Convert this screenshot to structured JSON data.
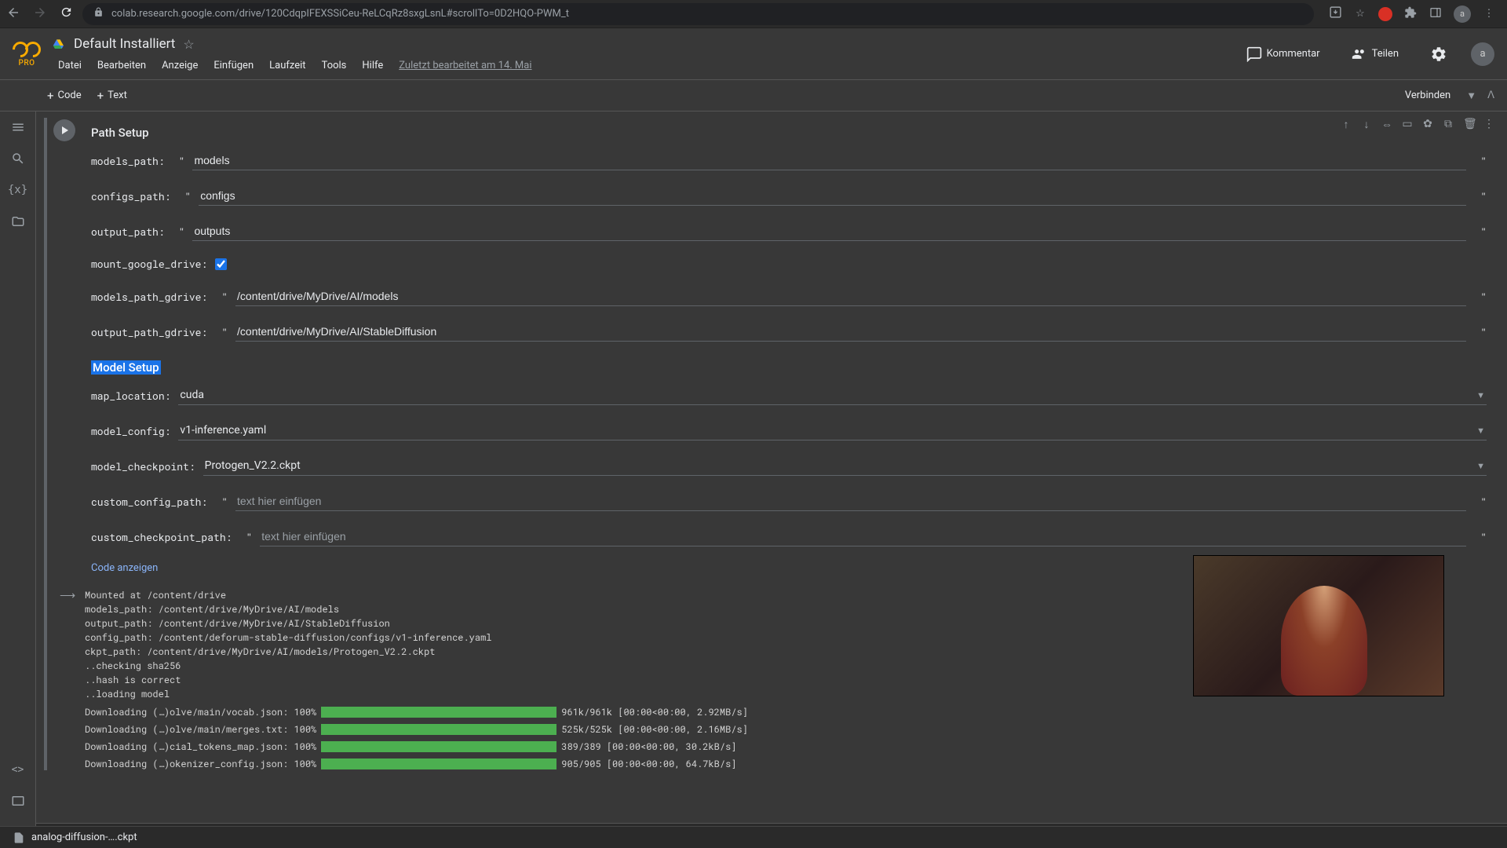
{
  "browser": {
    "url": "colab.research.google.com/drive/120CdqpIFEXSSiCeu-ReLCqRz8sxgLsnL#scrollTo=0D2HQO-PWM_t"
  },
  "header": {
    "pro_badge": "PRO",
    "title": "Default Installiert",
    "menus": [
      "Datei",
      "Bearbeiten",
      "Anzeige",
      "Einfügen",
      "Laufzeit",
      "Tools",
      "Hilfe"
    ],
    "last_edit": "Zuletzt bearbeitet am 14. Mai",
    "comment": "Kommentar",
    "share": "Teilen",
    "avatar": "a"
  },
  "toolbar": {
    "code_btn": "Code",
    "text_btn": "Text",
    "connect": "Verbinden"
  },
  "cell": {
    "section1_title": "Path Setup",
    "section2_title": "Model Setup",
    "params": {
      "models_path": {
        "label": "models_path:",
        "value": "models"
      },
      "configs_path": {
        "label": "configs_path:",
        "value": "configs"
      },
      "output_path": {
        "label": "output_path:",
        "value": "outputs"
      },
      "mount_google_drive": {
        "label": "mount_google_drive:"
      },
      "models_path_gdrive": {
        "label": "models_path_gdrive:",
        "value": "/content/drive/MyDrive/AI/models"
      },
      "output_path_gdrive": {
        "label": "output_path_gdrive:",
        "value": "/content/drive/MyDrive/AI/StableDiffusion"
      },
      "map_location": {
        "label": "map_location:",
        "value": "cuda"
      },
      "model_config": {
        "label": "model_config:",
        "value": "v1-inference.yaml"
      },
      "model_checkpoint": {
        "label": "model_checkpoint:",
        "value": "Protogen_V2.2.ckpt"
      },
      "custom_config_path": {
        "label": "custom_config_path:",
        "placeholder": "text hier einfügen"
      },
      "custom_checkpoint_path": {
        "label": "custom_checkpoint_path:",
        "placeholder": "text hier einfügen"
      }
    },
    "show_code": "Code anzeigen"
  },
  "output": {
    "lines": "Mounted at /content/drive\nmodels_path: /content/drive/MyDrive/AI/models\noutput_path: /content/drive/MyDrive/AI/StableDiffusion\nconfig_path: /content/deforum-stable-diffusion/configs/v1-inference.yaml\nckpt_path: /content/drive/MyDrive/AI/models/Protogen_V2.2.ckpt\n..checking sha256\n..hash is correct\n..loading model",
    "downloads": [
      {
        "label": "Downloading (…)olve/main/vocab.json: 100%",
        "info": "961k/961k [00:00<00:00, 2.92MB/s]"
      },
      {
        "label": "Downloading (…)olve/main/merges.txt: 100%",
        "info": "525k/525k [00:00<00:00, 2.16MB/s]"
      },
      {
        "label": "Downloading (…)cial_tokens_map.json: 100%",
        "info": "389/389 [00:00<00:00, 30.2kB/s]"
      },
      {
        "label": "Downloading (…)okenizer_config.json: 100%",
        "info": "905/905 [00:00<00:00, 64.7kB/s]"
      }
    ]
  },
  "downloads_bar": {
    "file": "analog-diffusion-….ckpt"
  }
}
